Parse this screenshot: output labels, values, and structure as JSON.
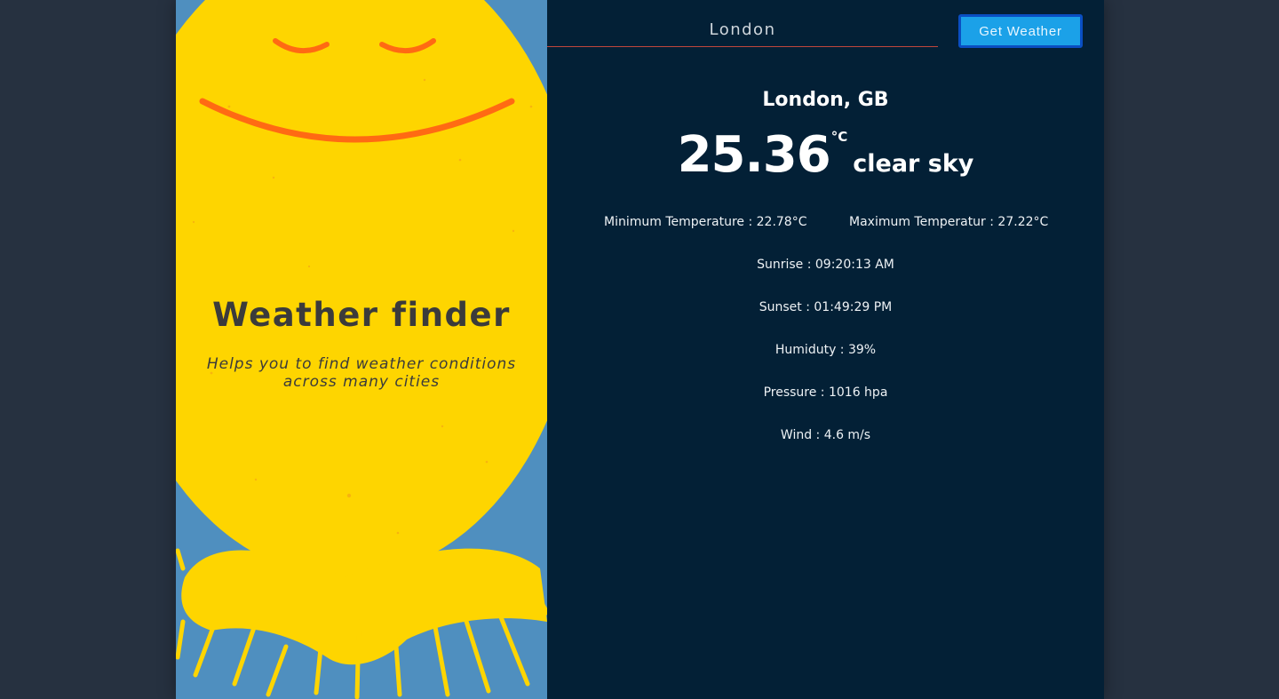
{
  "sidebar": {
    "title": "Weather finder",
    "subtitle": "Helps you to find weather conditions across many cities"
  },
  "search": {
    "value": "London",
    "button_label": "Get Weather"
  },
  "weather": {
    "location": "London, GB",
    "temperature": "25.36",
    "unit": "°C",
    "condition": "clear sky",
    "min_temp": "Minimum Temperature : 22.78°C",
    "max_temp": "Maximum Temperatur : 27.22°C",
    "sunrise": "Sunrise : 09:20:13 AM",
    "sunset": "Sunset : 01:49:29 PM",
    "humidity": "Humiduty : 39%",
    "pressure": "Pressure : 1016 hpa",
    "wind": "Wind : 4.6 m/s"
  },
  "colors": {
    "page_background": "#263140",
    "panel_background": "#032036",
    "sun_yellow": "#fed500",
    "sky_blue": "#4f8fbf",
    "face_orange": "#ff6a13",
    "button_blue": "#1ba1e8"
  }
}
